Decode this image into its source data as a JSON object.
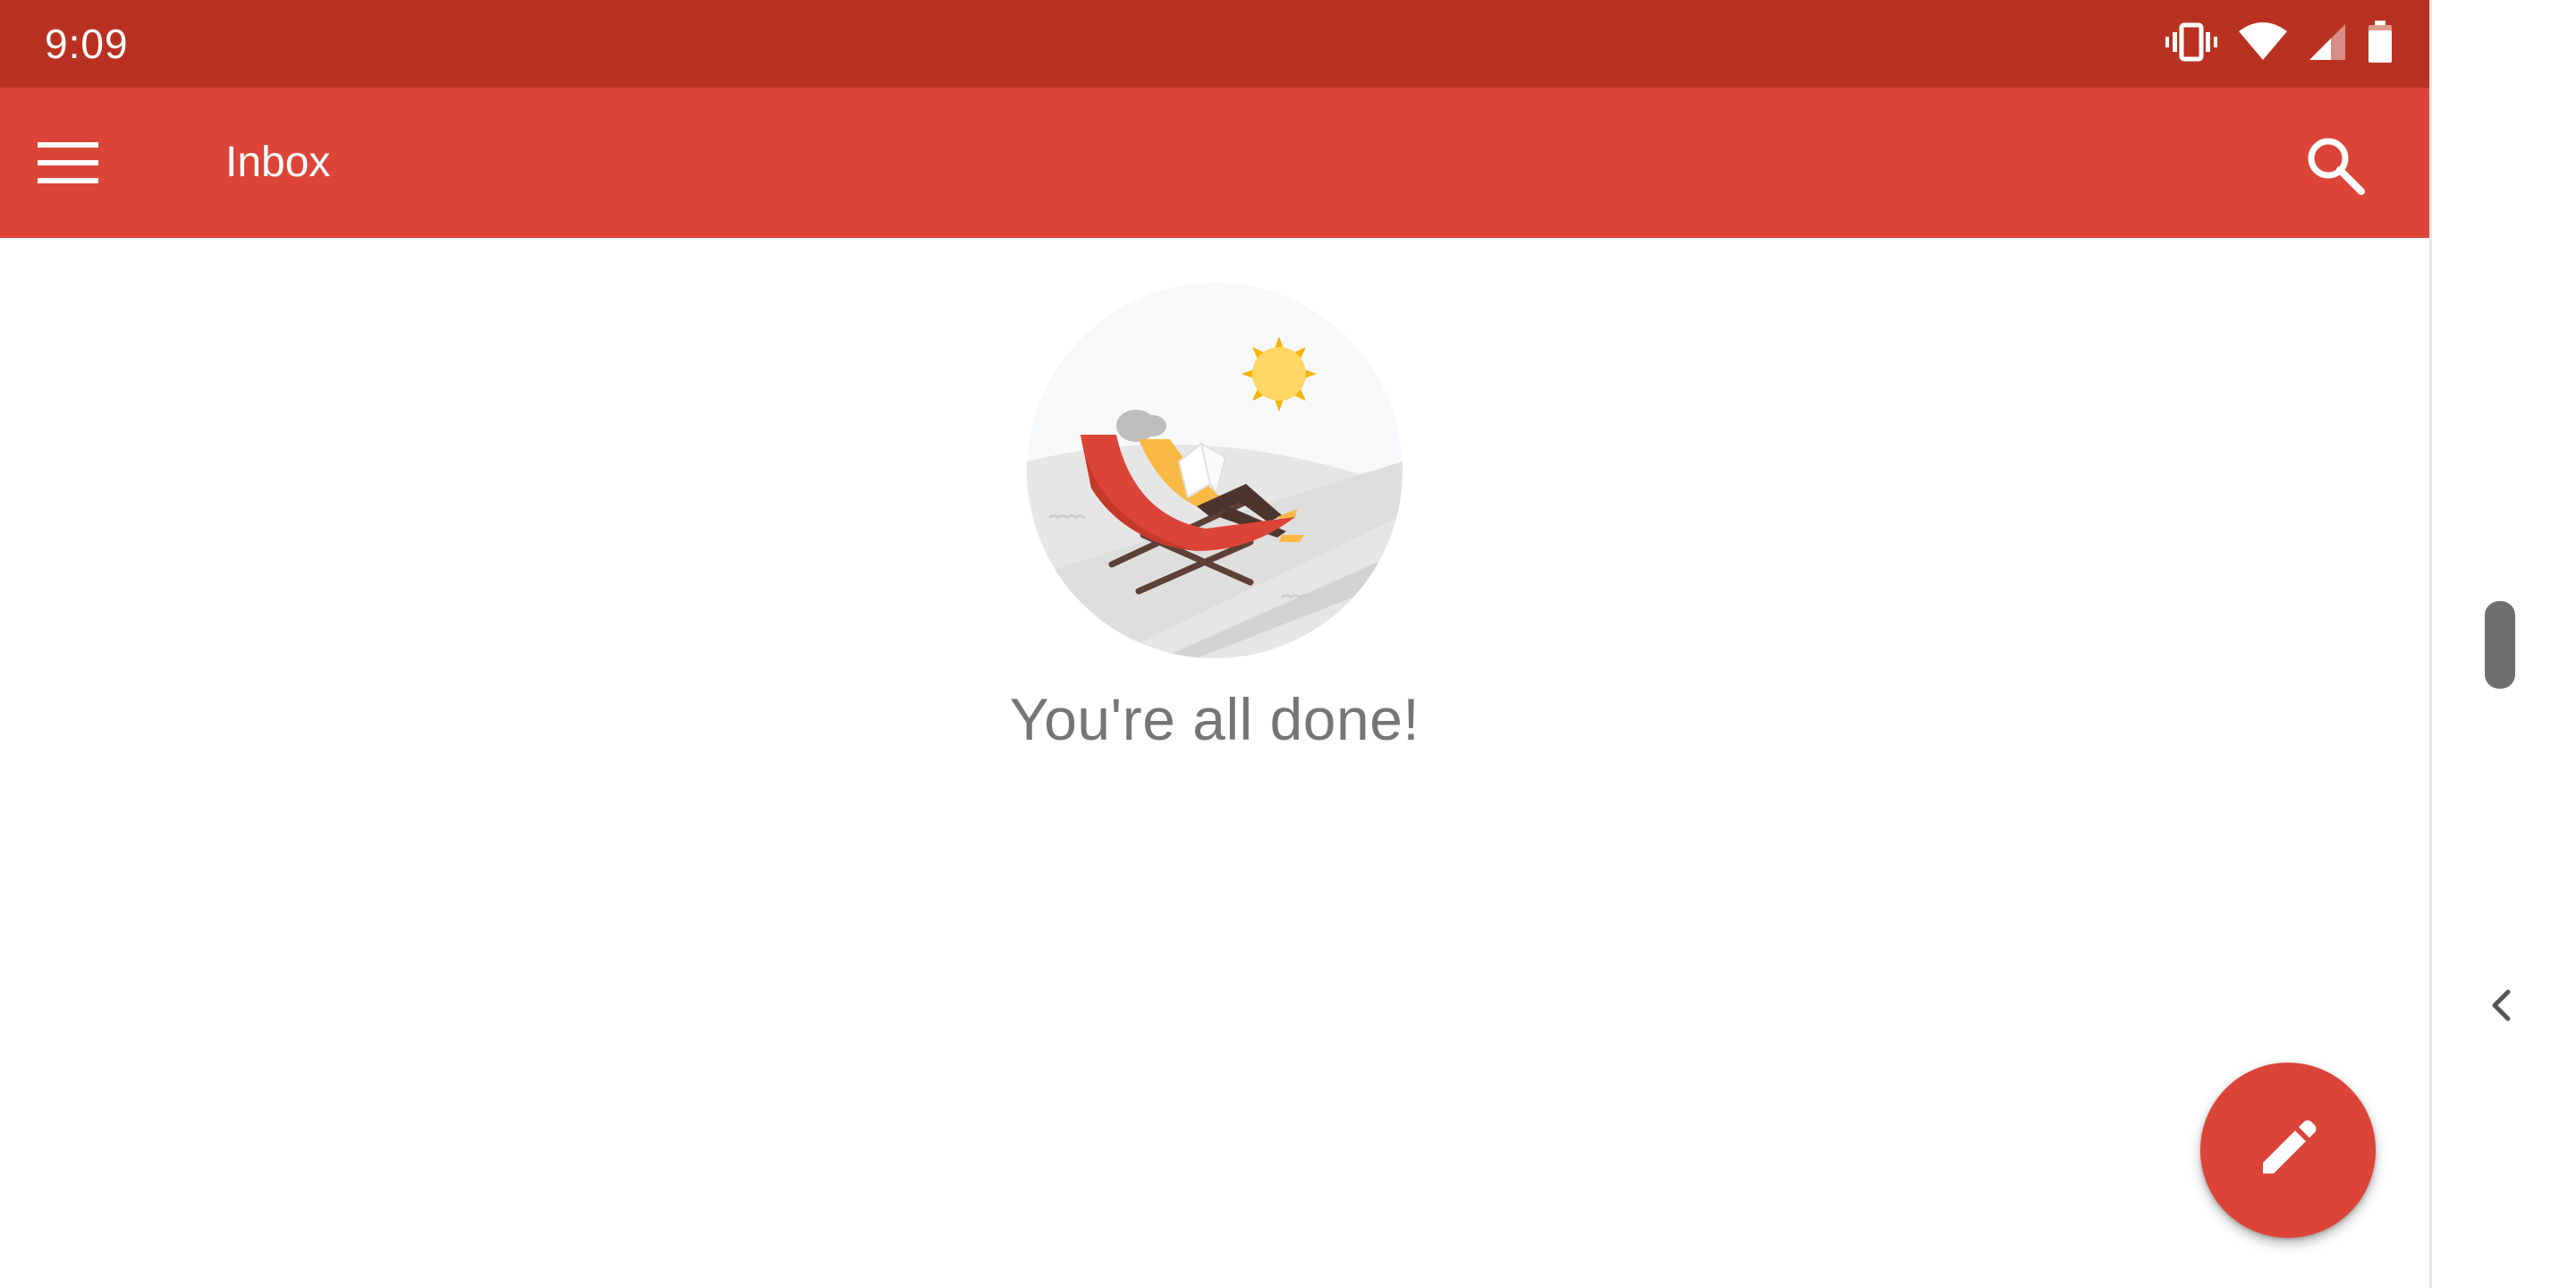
{
  "status_bar": {
    "time": "9:09",
    "icons": [
      "vibrate-icon",
      "wifi-icon",
      "signal-icon",
      "battery-icon"
    ],
    "background": "#b93221"
  },
  "app_bar": {
    "title": "Inbox",
    "background": "#db4437",
    "menu_icon": "hamburger-menu-icon",
    "search_icon": "search-icon"
  },
  "empty_state": {
    "message": "You're all done!",
    "illustration": "person-relaxing-in-beach-chair-illustration"
  },
  "fab": {
    "icon": "pencil-icon",
    "color": "#db4437"
  },
  "side_panel": {
    "handle_icon": "drag-handle",
    "chevron_icon": "chevron-left-icon"
  }
}
